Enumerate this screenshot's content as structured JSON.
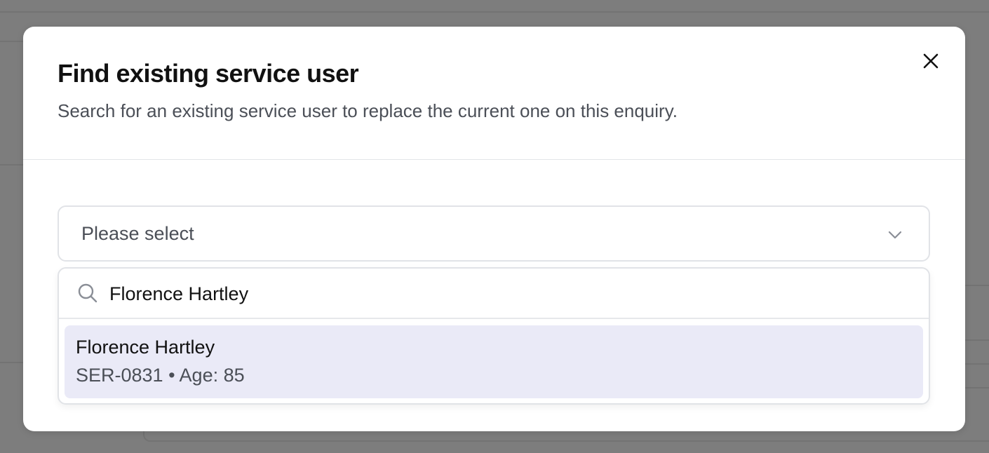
{
  "modal": {
    "title": "Find existing service user",
    "description": "Search for an existing service user to replace the current one on this enquiry.",
    "close_icon": "close-icon"
  },
  "select": {
    "value": "Please select",
    "icon": "chevron-down-icon"
  },
  "dropdown": {
    "search": {
      "value": "Florence Hartley",
      "icon": "search-icon"
    },
    "options": [
      {
        "name": "Florence Hartley",
        "meta": "SER-0831 • Age: 85",
        "highlighted": true
      }
    ]
  },
  "colors": {
    "overlay": "#7d7d7d",
    "highlight": "#eaeaf7",
    "text": "#111111",
    "muted": "#4b4f57"
  }
}
